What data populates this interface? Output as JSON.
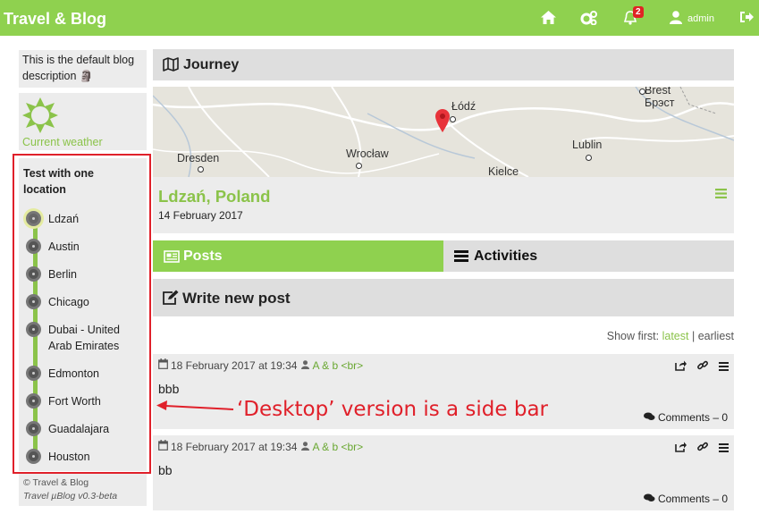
{
  "header": {
    "brand": "Travel & Blog",
    "notifications_count": "2",
    "user_label": "admin",
    "icons": [
      "home-icon",
      "settings-icon",
      "bell-icon",
      "user-icon",
      "logout-icon"
    ]
  },
  "sidebar": {
    "description": "This is the default blog description 🗿",
    "weather_label": "Current weather",
    "trip_title": "Test with one location",
    "locations": [
      "Ldzań",
      "Austin",
      "Berlin",
      "Chicago",
      "Dubai - United Arab Emirates",
      "Edmonton",
      "Fort Worth",
      "Guadalajara",
      "Houston"
    ],
    "footer_copyright": "© Travel & Blog",
    "footer_version": "Travel µBlog v0.3-beta"
  },
  "journey": {
    "title": "Journey",
    "map_cities": [
      "Brest",
      "Брэст",
      "Łódź",
      "Wrocław",
      "Lublin",
      "Dresden",
      "Kielce"
    ]
  },
  "place": {
    "name": "Ldzań, Poland",
    "date": "14 February 2017"
  },
  "tabs": {
    "posts": "Posts",
    "activities": "Activities"
  },
  "write_post": {
    "label": "Write new post"
  },
  "sort": {
    "prefix": "Show first:",
    "latest": "latest",
    "separator": "|",
    "earliest": "earliest"
  },
  "posts": [
    {
      "date": "18 February 2017 at 19:34",
      "author": "A & b <br>",
      "body": "bbb",
      "comments": "Comments – 0"
    },
    {
      "date": "18 February 2017 at 19:34",
      "author": "A & b <br>",
      "body": "bb",
      "comments": "Comments – 0"
    }
  ],
  "annotation": {
    "text": "‘Desktop’ version is a side bar",
    "color": "#e0202a"
  },
  "colors": {
    "accent": "#8fd14f",
    "link": "#8bc34a",
    "annotation": "#e0202a"
  }
}
